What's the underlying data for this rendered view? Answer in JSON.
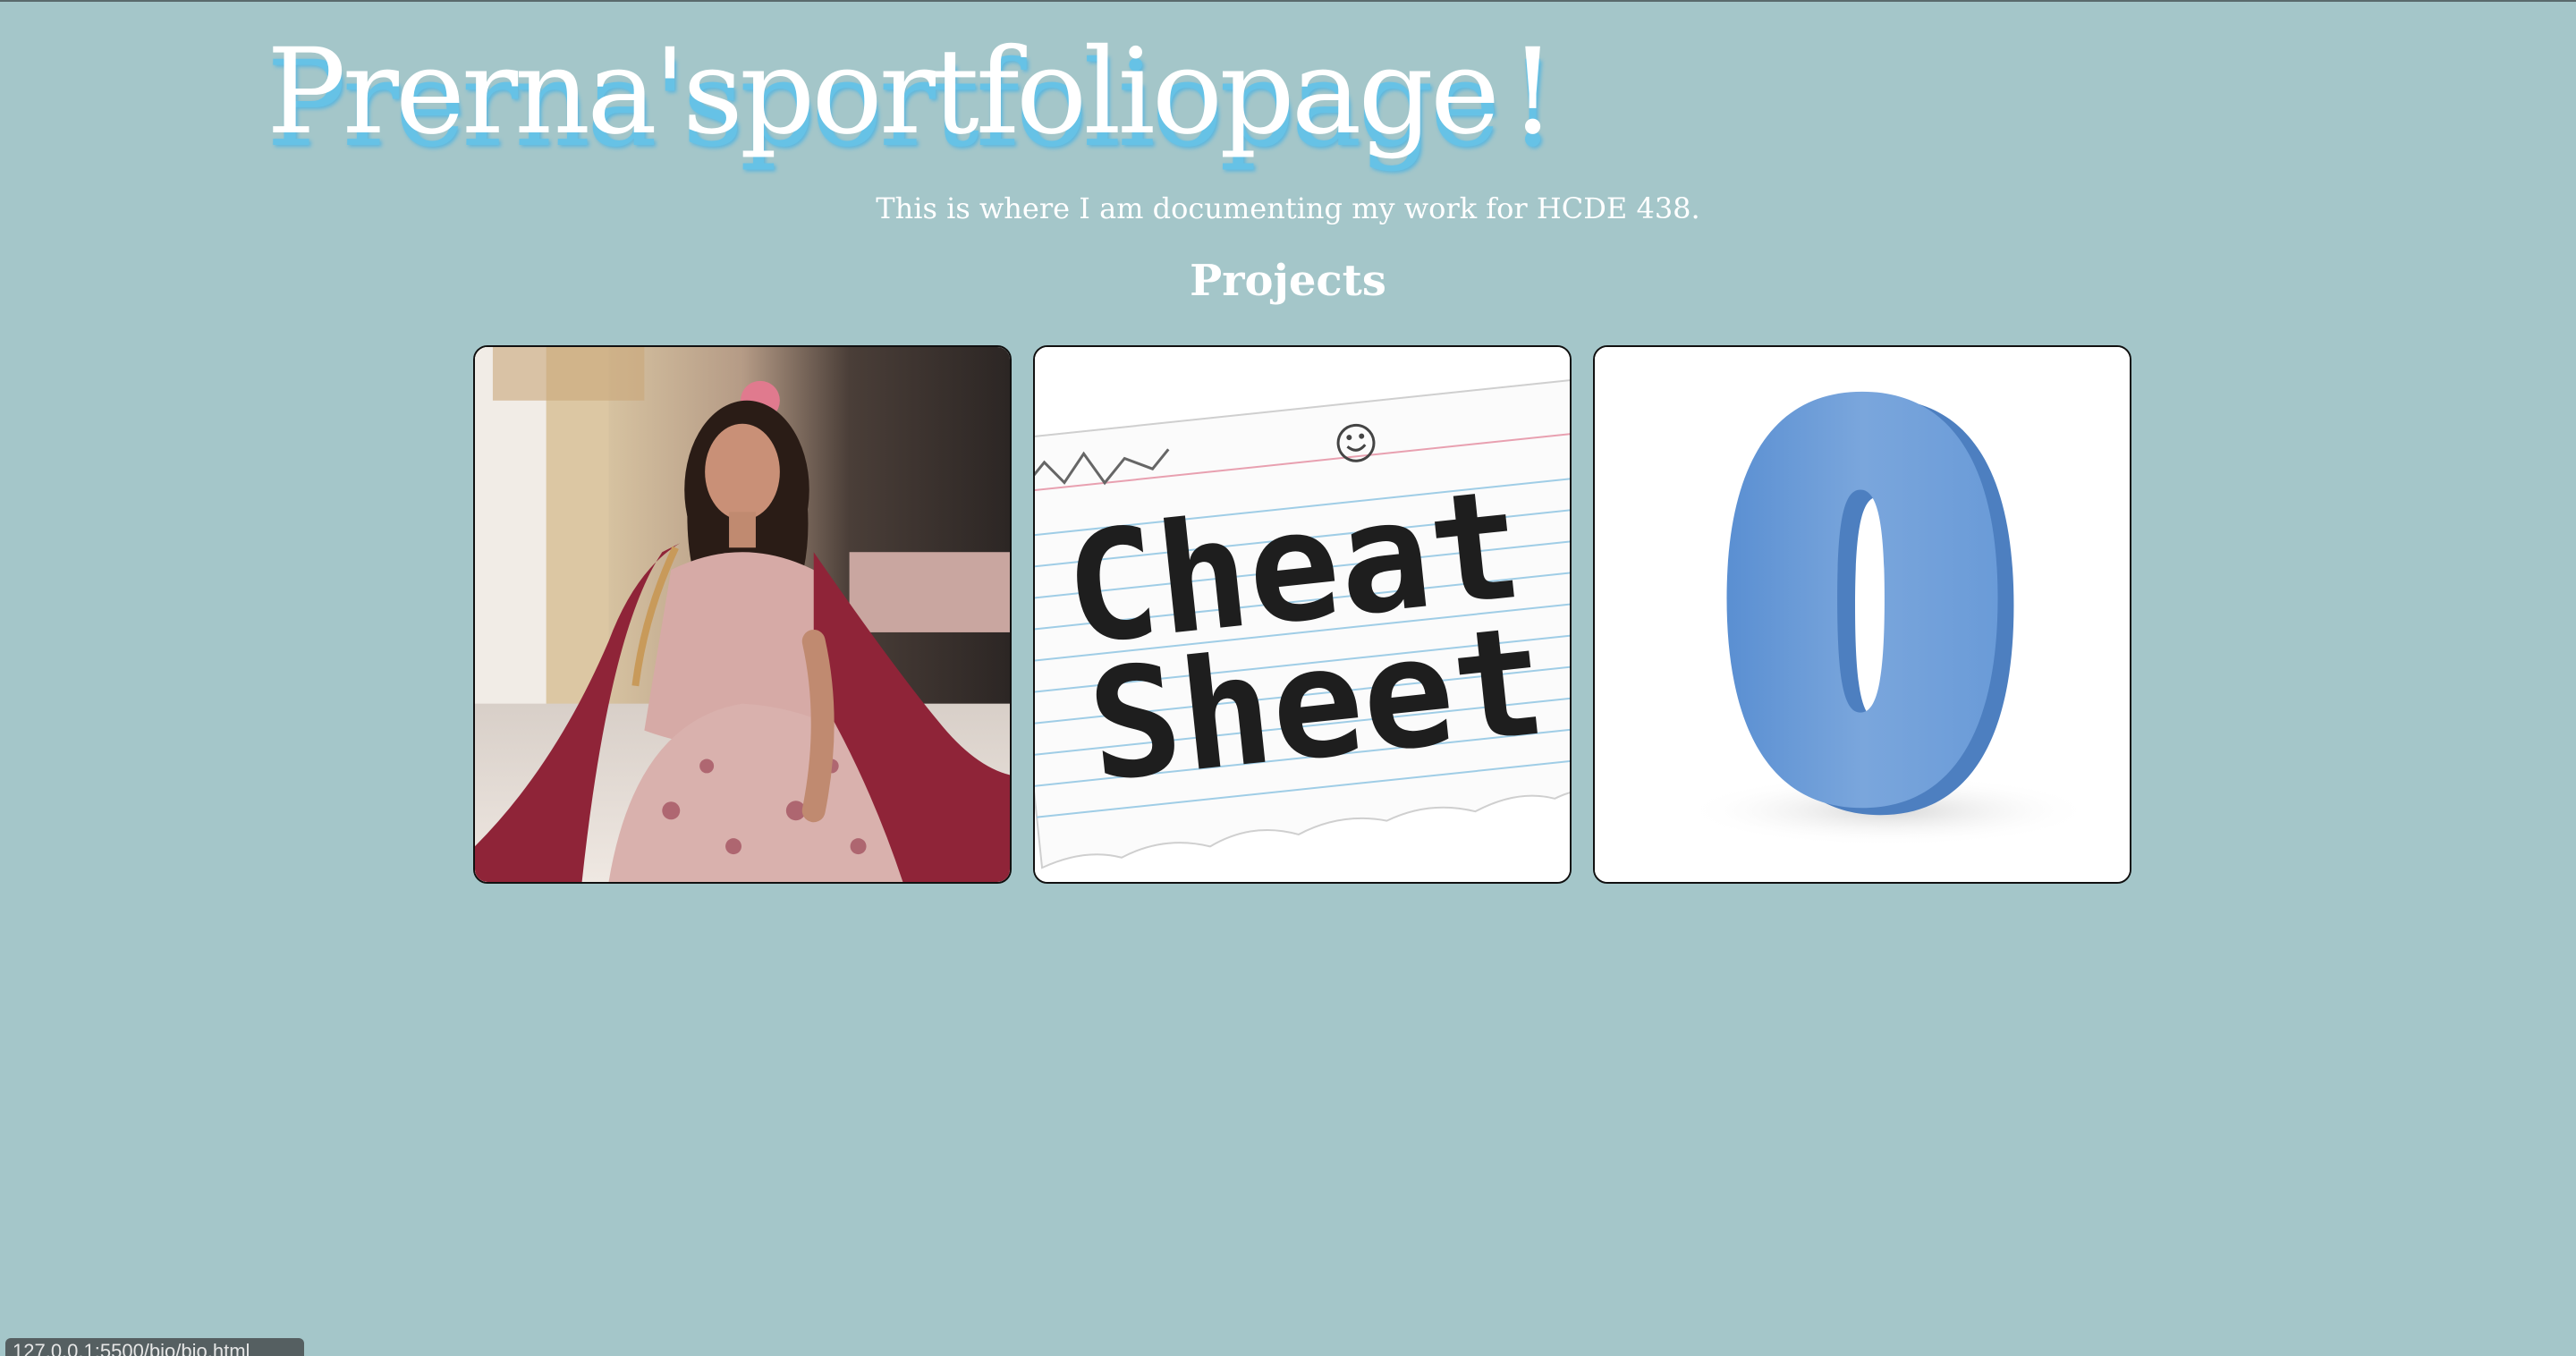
{
  "page": {
    "title_parts": [
      "Prerna's",
      "portfolio",
      "page",
      "!"
    ],
    "subtitle": "This is where I am documenting my work for HCDE 438.",
    "section_heading": "Projects"
  },
  "projects": [
    {
      "alt": "portrait"
    },
    {
      "alt": "cheat sheet",
      "image_text_line1": "Cheat",
      "image_text_line2": "Sheet"
    },
    {
      "alt": "zero",
      "image_text": "0"
    }
  ],
  "status_bar": {
    "url": "127.0.0.1:5500/bio/bio.html"
  },
  "colors": {
    "background": "#a4c6c9",
    "title_shadow": "#66c2e6",
    "zero_blue": "#7aa6dc"
  }
}
